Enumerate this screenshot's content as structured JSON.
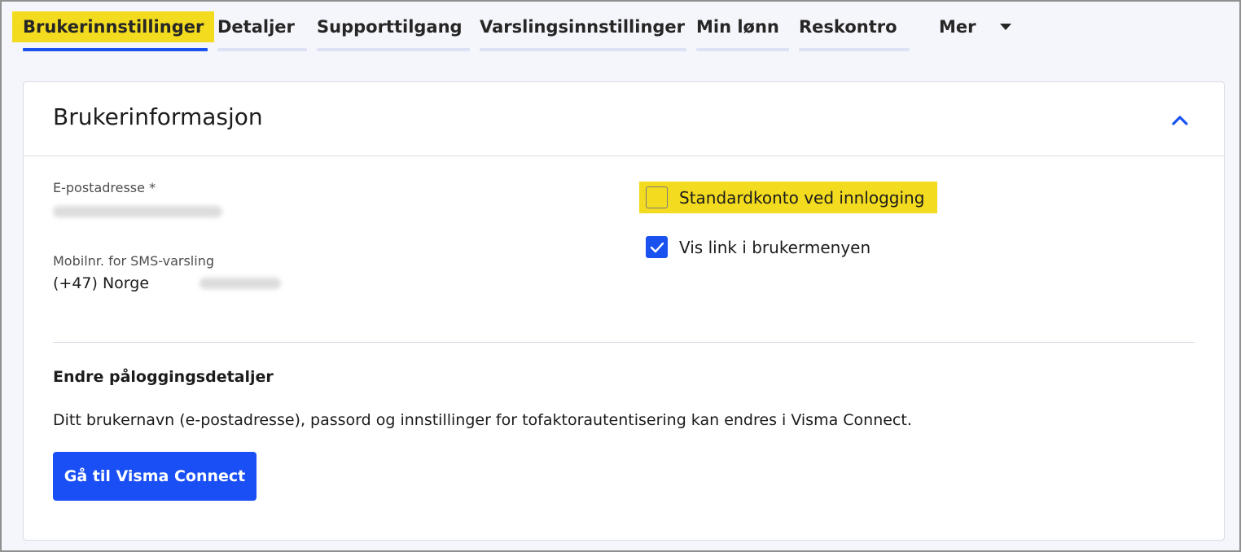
{
  "tabs": [
    {
      "label": "Brukerinnstillinger",
      "active": true,
      "highlighted": true
    },
    {
      "label": "Detaljer"
    },
    {
      "label": "Supporttilgang"
    },
    {
      "label": "Varslingsinnstillinger"
    },
    {
      "label": "Min lønn"
    },
    {
      "label": "Reskontro"
    },
    {
      "label": "Mer"
    }
  ],
  "card": {
    "title": "Brukerinformasjon",
    "email_label": "E-postadresse *",
    "mobile_label": "Mobilnr. for SMS-varsling",
    "mobile_country": "(+47) Norge",
    "checkboxes": [
      {
        "label": "Standardkonto ved innlogging",
        "checked": false,
        "highlighted": true
      },
      {
        "label": "Vis link i brukermenyen",
        "checked": true
      }
    ],
    "section_heading": "Endre påloggingsdetaljer",
    "section_text": "Ditt brukernavn (e-postadresse), passord og innstillinger for tofaktorautentisering kan endres i Visma Connect.",
    "button_label": "Gå til Visma Connect"
  },
  "colors": {
    "accent": "#1a52f0",
    "highlight": "#f3db1f",
    "background": "#f5f6fb"
  }
}
